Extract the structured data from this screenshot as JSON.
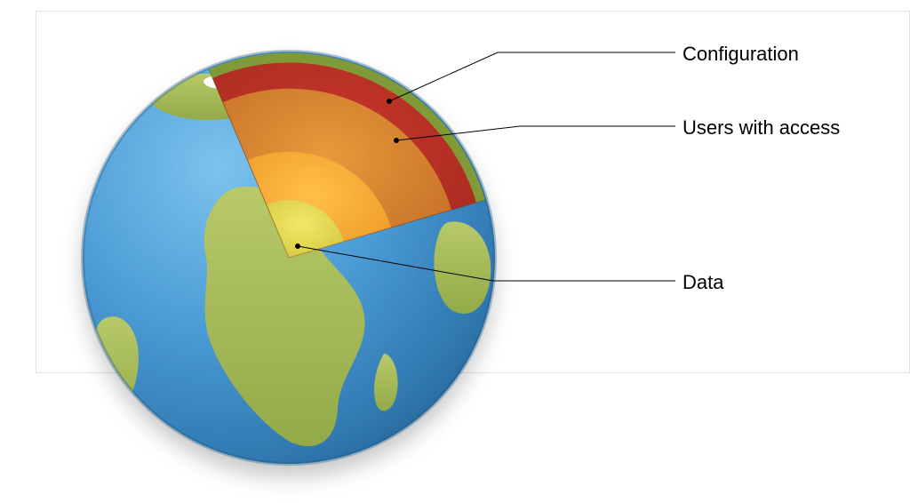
{
  "diagram": {
    "labels": {
      "outer": "Configuration",
      "middle": "Users with access",
      "inner": "Data"
    },
    "layers": [
      {
        "name": "Configuration",
        "role": "outer shell (crust)"
      },
      {
        "name": "Users with access",
        "role": "mantle"
      },
      {
        "name": "Data",
        "role": "core"
      }
    ],
    "colors": {
      "ocean_hi": "#5aaadf",
      "ocean": "#3f8fcf",
      "ocean_lo": "#2f77b0",
      "land": "#a9bb5a",
      "land_dk": "#8aa642",
      "crust_out": "#6a8a2f",
      "crust_in": "#b02f23",
      "mantle_out": "#d07a2a",
      "mantle_in": "#e68a1f",
      "outer_core": "#f2a020",
      "inner_core": "#d4c83a"
    }
  }
}
